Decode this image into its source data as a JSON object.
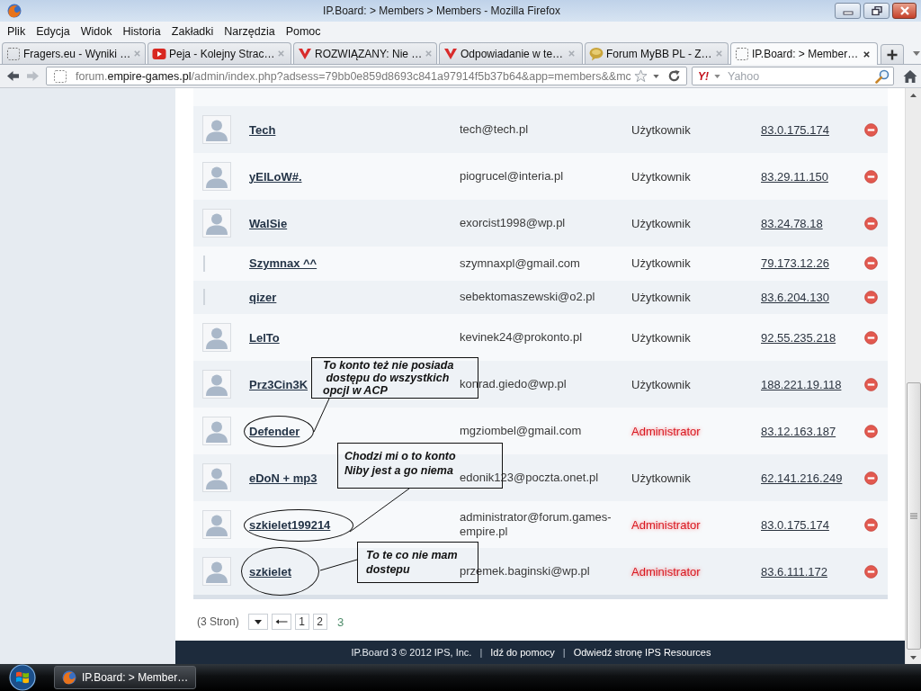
{
  "window": {
    "title": "IP.Board: > Members > Members - Mozilla Firefox"
  },
  "menu": [
    "Plik",
    "Edycja",
    "Widok",
    "Historia",
    "Zakładki",
    "Narzędzia",
    "Pomoc"
  ],
  "tabs": [
    {
      "label": "Fragers.eu - Wyniki …",
      "kind": "blank",
      "selected": false
    },
    {
      "label": "Peja - Kolejny Strac…",
      "kind": "video",
      "selected": false
    },
    {
      "label": "ROZWIĄZANY: Nie …",
      "kind": "mark",
      "selected": false
    },
    {
      "label": "Odpowiadanie w te…",
      "kind": "mark",
      "selected": false
    },
    {
      "label": "Forum MyBB PL - Z…",
      "kind": "bubble",
      "selected": false
    },
    {
      "label": "IP.Board: > Member…",
      "kind": "blank",
      "selected": true
    }
  ],
  "navigation": {
    "back_disabled": false,
    "forward_disabled": true
  },
  "address": {
    "subdomain": "forum.",
    "domain": "empire-games.pl",
    "path": "/admin/index.php?adsess=79bb0e859d8693c841a97914f5b37b64&app=members&&mc"
  },
  "search": {
    "engine": "Y!",
    "placeholder": "Yahoo"
  },
  "members": [
    {
      "name": "Tech",
      "email": "tech@tech.pl",
      "group": {
        "text": "Użytkownik",
        "kind": "member"
      },
      "ip": "83.0.175.174",
      "avatar": true,
      "circled": false
    },
    {
      "name": "yElLoW#.",
      "email": "piogrucel@interia.pl",
      "group": {
        "text": "Użytkownik",
        "kind": "member"
      },
      "ip": "83.29.11.150",
      "avatar": true,
      "circled": false
    },
    {
      "name": "WalSie",
      "email": "exorcist1998@wp.pl",
      "group": {
        "text": "Użytkownik",
        "kind": "member"
      },
      "ip": "83.24.78.18",
      "avatar": true,
      "circled": false
    },
    {
      "name": "Szymnax ^^",
      "email": "szymnaxpl@gmail.com",
      "group": {
        "text": "Użytkownik",
        "kind": "member"
      },
      "ip": "79.173.12.26",
      "avatar": false,
      "circled": false
    },
    {
      "name": "qizer",
      "email": "sebektomaszewski@o2.pl",
      "group": {
        "text": "Użytkownik",
        "kind": "member"
      },
      "ip": "83.6.204.130",
      "avatar": false,
      "circled": false
    },
    {
      "name": "LelTo",
      "email": "kevinek24@prokonto.pl",
      "group": {
        "text": "Użytkownik",
        "kind": "member"
      },
      "ip": "92.55.235.218",
      "avatar": true,
      "circled": false
    },
    {
      "name": "Prz3Cin3K",
      "email": "konrad.giedo@wp.pl",
      "group": {
        "text": "Użytkownik",
        "kind": "member"
      },
      "ip": "188.221.19.118",
      "avatar": true,
      "circled": false
    },
    {
      "name": "Defender",
      "email": "mgziombel@gmail.com",
      "group": {
        "text": "Administrator",
        "kind": "admin"
      },
      "ip": "83.12.163.187",
      "avatar": true,
      "circled": true
    },
    {
      "name": "eDoN + mp3",
      "email": "edonik123@poczta.onet.pl",
      "group": {
        "text": "Użytkownik",
        "kind": "member"
      },
      "ip": "62.141.216.249",
      "avatar": true,
      "circled": false
    },
    {
      "name": "szkielet199214",
      "email": "administrator@forum.games-empire.pl",
      "group": {
        "text": "Administrator",
        "kind": "admin"
      },
      "ip": "83.0.175.174",
      "avatar": true,
      "circled": true
    },
    {
      "name": "szkielet",
      "email": "przemek.baginski@wp.pl",
      "group": {
        "text": "Administrator",
        "kind": "admin"
      },
      "ip": "83.6.111.172",
      "avatar": true,
      "circled": true
    }
  ],
  "annotations": [
    {
      "text": "To konto też nie posiada\n dostępu do wszystkich\nopcjI w ACP"
    },
    {
      "text": "Chodzi mi o to konto\nNiby jest a go niema"
    },
    {
      "text": "To te co nie mam\ndostepu"
    }
  ],
  "pagination": {
    "summary": "(3 Stron)",
    "pages": [
      {
        "label": "1",
        "selected": false
      },
      {
        "label": "2",
        "selected": false
      },
      {
        "label": "3",
        "selected": true
      }
    ]
  },
  "footer": [
    {
      "kind": "text",
      "text": "IP.Board 3 © 2012 IPS, Inc."
    },
    {
      "kind": "separator",
      "text": "|"
    },
    {
      "kind": "link",
      "text": "Idź do pomocy"
    },
    {
      "kind": "separator",
      "text": "|"
    },
    {
      "kind": "link",
      "text": "Odwiedź stronę IPS Resources"
    }
  ],
  "taskbar": {
    "tasks": [
      {
        "label": "IP.Board: > Member…"
      }
    ]
  }
}
